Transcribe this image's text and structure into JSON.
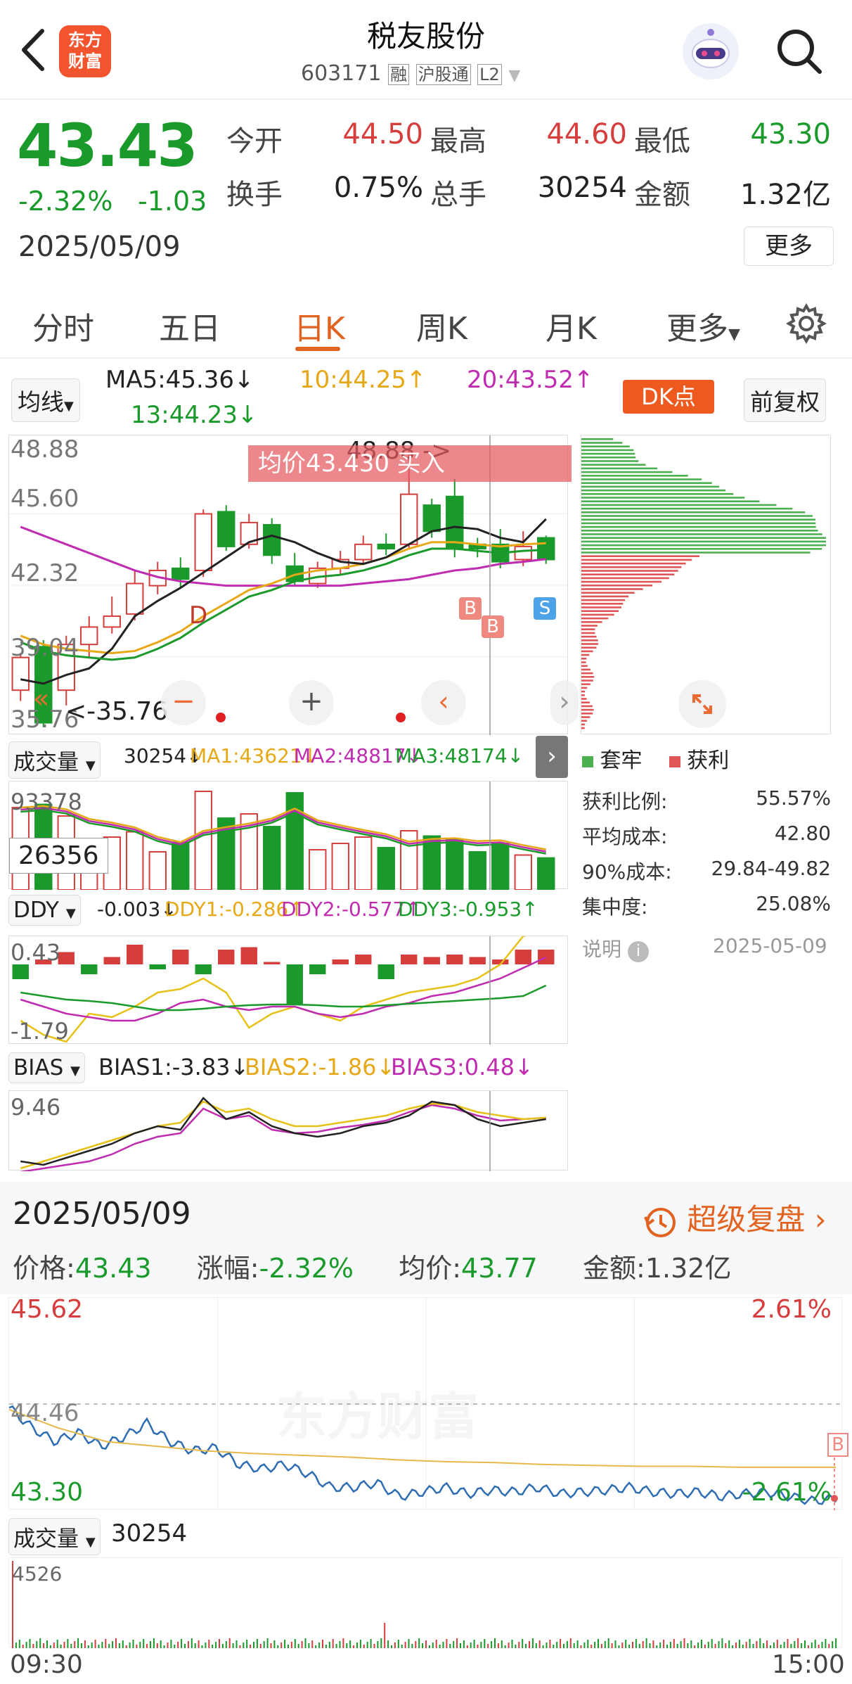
{
  "header": {
    "stock_name": "税友股份",
    "code": "603171",
    "badges": [
      "融",
      "沪股通",
      "L2"
    ],
    "logo_text": "东方\n财富"
  },
  "quote": {
    "price": "43.43",
    "change_pct": "-2.32%",
    "change": "-1.03",
    "date": "2025/05/09",
    "stats": [
      {
        "label": "今开",
        "value": "44.50",
        "color": "#d63d3d"
      },
      {
        "label": "最高",
        "value": "44.60",
        "color": "#d63d3d"
      },
      {
        "label": "最低",
        "value": "43.30",
        "color": "#1b9a2c"
      },
      {
        "label": "换手",
        "value": "0.75%",
        "color": "#222"
      },
      {
        "label": "总手",
        "value": "30254",
        "color": "#222"
      },
      {
        "label": "金额",
        "value": "1.32亿",
        "color": "#222"
      }
    ],
    "more_label": "更多"
  },
  "tabs": [
    "分时",
    "五日",
    "日K",
    "周K",
    "月K",
    "更多"
  ],
  "active_tab": "日K",
  "ma_bar": {
    "selector": "均线",
    "ma5": "MA5:45.36↓",
    "ma10": "10:44.25↑",
    "ma20": "20:43.52↑",
    "ma13": "13:44.23↓",
    "dk": "DK点",
    "adj": "前复权"
  },
  "kchart": {
    "y_labels": [
      "48.88",
      "45.60",
      "42.32",
      "39.04",
      "35.76"
    ],
    "high_annot": "48.88 ->",
    "low_annot": "<-35.76",
    "tooltip": "均价43.430 买入",
    "markers": [
      "D",
      "B",
      "B",
      "S"
    ]
  },
  "volume_bar": {
    "selector": "成交量",
    "v": "30254↓",
    "ma1": "MA1:43621↓",
    "ma2": "MA2:48817↓",
    "ma3": "MA3:48174↓",
    "y_top": "93378",
    "crosshair_val": "26356"
  },
  "ddy_bar": {
    "selector": "DDY",
    "v": "-0.003↓",
    "d1": "DDY1:-0.286↑",
    "d2": "DDY2:-0.577↑",
    "d3": "DDY3:-0.953↑",
    "y_top": "0.43",
    "y_bot": "-1.79"
  },
  "bias_bar": {
    "selector": "BIAS",
    "b1": "BIAS1:-3.83↓",
    "b2": "BIAS2:-1.86↓",
    "b3": "BIAS3:0.48↓",
    "y_top": "9.46"
  },
  "chip": {
    "legend": [
      {
        "label": "套牢",
        "color": "#4caf50"
      },
      {
        "label": "获利",
        "color": "#e05555"
      }
    ],
    "rows": [
      {
        "label": "获利比例:",
        "value": "55.57%"
      },
      {
        "label": "平均成本:",
        "value": "42.80"
      },
      {
        "label": "90%成本:",
        "value": "29.84-49.82"
      },
      {
        "label": "集中度:",
        "value": "25.08%"
      }
    ],
    "note_label": "说明",
    "note_date": "2025-05-09"
  },
  "intraday": {
    "date": "2025/05/09",
    "replay": "超级复盘 ›",
    "info": {
      "price_label": "价格:",
      "price": "43.43",
      "chg_label": "涨幅:",
      "chg": "-2.32%",
      "avg_label": "均价:",
      "avg": "43.77",
      "amt_label": "金额:",
      "amt": "1.32亿"
    },
    "y_top": "45.62",
    "y_mid": "44.46",
    "y_bot": "43.30",
    "pct_top": "2.61%",
    "pct_bot": "-2.61%",
    "vol_selector": "成交量",
    "vol_value": "30254",
    "vol_top": "4526",
    "t_start": "09:30",
    "t_end": "15:00",
    "marker": "B",
    "watermark": "东方财富"
  },
  "chart_data": {
    "type": "candlestick",
    "candles": [
      [
        37.5,
        39.0,
        37.0,
        39.2
      ],
      [
        39.5,
        36.0,
        35.8,
        39.8
      ],
      [
        37.5,
        39.6,
        36.8,
        40.0
      ],
      [
        39.6,
        40.4,
        39.0,
        40.9
      ],
      [
        40.4,
        40.9,
        40.1,
        41.8
      ],
      [
        41.0,
        42.4,
        40.7,
        43.0
      ],
      [
        42.3,
        43.0,
        41.9,
        43.4
      ],
      [
        43.1,
        42.6,
        42.2,
        43.6
      ],
      [
        43.0,
        45.6,
        42.7,
        45.8
      ],
      [
        45.7,
        44.1,
        43.9,
        46.0
      ],
      [
        44.2,
        45.2,
        44.0,
        45.6
      ],
      [
        45.1,
        43.7,
        43.3,
        45.4
      ],
      [
        43.2,
        42.5,
        42.3,
        43.8
      ],
      [
        42.4,
        43.1,
        42.2,
        43.4
      ],
      [
        43.1,
        43.5,
        42.8,
        43.9
      ],
      [
        43.5,
        44.2,
        43.3,
        44.6
      ],
      [
        44.2,
        44.0,
        43.7,
        44.7
      ],
      [
        44.2,
        46.5,
        44.0,
        48.5
      ],
      [
        46.0,
        44.8,
        44.5,
        46.3
      ],
      [
        46.4,
        44.0,
        43.6,
        47.2
      ],
      [
        44.2,
        44.0,
        43.6,
        44.5
      ],
      [
        44.2,
        43.4,
        43.1,
        44.9
      ],
      [
        43.5,
        44.1,
        43.2,
        44.8
      ],
      [
        44.5,
        43.5,
        43.3,
        44.6
      ]
    ],
    "ma5": [
      38.0,
      37.8,
      38.2,
      38.5,
      39.4,
      40.9,
      41.6,
      42.2,
      42.9,
      43.6,
      44.3,
      44.6,
      44.3,
      43.8,
      43.4,
      43.3,
      43.6,
      44.2,
      44.8,
      45.0,
      44.9,
      44.5,
      44.3,
      45.36
    ],
    "ma10": [
      40.0,
      39.6,
      39.4,
      39.3,
      39.2,
      39.3,
      39.7,
      40.2,
      40.9,
      41.5,
      42.1,
      42.4,
      42.8,
      43.0,
      43.1,
      43.3,
      43.6,
      44.0,
      44.3,
      44.3,
      44.2,
      44.1,
      44.2,
      44.25
    ],
    "ma20": [
      45.0,
      44.6,
      44.2,
      43.8,
      43.4,
      43.0,
      42.7,
      42.5,
      42.4,
      42.3,
      42.3,
      42.3,
      42.3,
      42.3,
      42.3,
      42.4,
      42.5,
      42.6,
      42.8,
      43.0,
      43.1,
      43.3,
      43.4,
      43.52
    ],
    "volume": [
      78000,
      81000,
      70000,
      40000,
      50000,
      55000,
      36000,
      45000,
      93378,
      68000,
      72000,
      60000,
      92000,
      38000,
      44000,
      50000,
      40000,
      56000,
      51000,
      48000,
      36000,
      44000,
      33000,
      30254
    ],
    "intraday_price": [
      44.42,
      44.2,
      44.05,
      44.15,
      44.0,
      44.1,
      44.25,
      44.05,
      43.95,
      43.98,
      43.8,
      43.75,
      43.8,
      43.7,
      43.55,
      43.55,
      43.6,
      43.45,
      43.5,
      43.55,
      43.48,
      43.52,
      43.5,
      43.55,
      43.48,
      43.5,
      43.52,
      43.55,
      43.5,
      43.48,
      43.5,
      43.45,
      43.48,
      43.5,
      43.45,
      43.4,
      43.43
    ],
    "intraday_avg": [
      44.4,
      44.2,
      44.05,
      44.0,
      43.95,
      43.92,
      43.9,
      43.88,
      43.85,
      43.83,
      43.82,
      43.8,
      43.79,
      43.78,
      43.78,
      43.77,
      43.77,
      43.77
    ]
  }
}
